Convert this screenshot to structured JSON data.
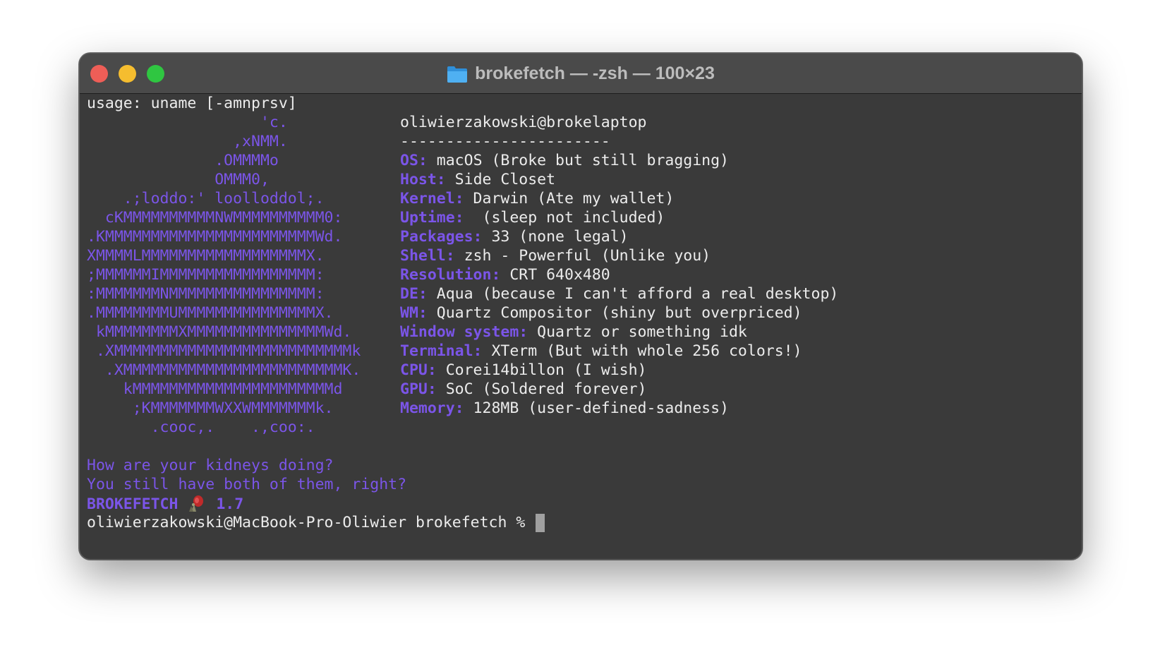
{
  "window": {
    "title": "brokefetch — -zsh — 100×23"
  },
  "terminal": {
    "usage_line": "usage: uname [-amnprsv]",
    "ascii_art": [
      "                   'c.",
      "                ,xNMM.",
      "              .OMMMMo",
      "              OMMM0,",
      "    .;loddo:' loolloddol;.",
      "  cKMMMMMMMMMMNWMMMMMMMMMM0:",
      ".KMMMMMMMMMMMMMMMMMMMMMMMWd.",
      "XMMMMLMMMMMMMMMMMMMMMMMMX.",
      ";MMMMMMIMMMMMMMMMMMMMMMMM:",
      ":MMMMMMMNMMMMMMMMMMMMMMMM:",
      ".MMMMMMMMUMMMMMMMMMMMMMMMX.",
      " kMMMMMMMMXMMMMMMMMMMMMMMMWd.",
      " .XMMMMMMMMMMMMMMMMMMMMMMMMMMk",
      "  .XMMMMMMMMMMMMMMMMMMMMMMMMK.",
      "    kMMMMMMMMMMMMMMMMMMMMMMd",
      "     ;KMMMMMMMWXXWMMMMMMMk.",
      "       .cooc,.    .,coo:."
    ],
    "user_host": "oliwierzakowski@brokelaptop",
    "separator": "-----------------------",
    "info": [
      {
        "key": "OS:",
        "value": " macOS (Broke but still bragging)"
      },
      {
        "key": "Host:",
        "value": " Side Closet"
      },
      {
        "key": "Kernel:",
        "value": " Darwin (Ate my wallet)"
      },
      {
        "key": "Uptime:",
        "value": "  (sleep not included)"
      },
      {
        "key": "Packages:",
        "value": " 33 (none legal)"
      },
      {
        "key": "Shell:",
        "value": " zsh - Powerful (Unlike you)"
      },
      {
        "key": "Resolution:",
        "value": " CRT 640x480"
      },
      {
        "key": "DE:",
        "value": " Aqua (because I can't afford a real desktop)"
      },
      {
        "key": "WM:",
        "value": " Quartz Compositor (shiny but overpriced)"
      },
      {
        "key": "Window system:",
        "value": " Quartz or something idk"
      },
      {
        "key": "Terminal:",
        "value": " XTerm (But with whole 256 colors!)"
      },
      {
        "key": "CPU:",
        "value": " Corei14billon (I wish)"
      },
      {
        "key": "GPU:",
        "value": " SoC (Soldered forever)"
      },
      {
        "key": "Memory:",
        "value": " 128MB (user-defined-sadness)"
      }
    ],
    "message_1": "How are your kidneys doing?",
    "message_2": "You still have both of them, right?",
    "brand": "BROKEFETCH",
    "version": "1.7",
    "prompt": "oliwierzakowski@MacBook-Pro-Oliwier brokefetch % "
  },
  "colors": {
    "accent": "#7b55e8",
    "background": "#3a3a3a",
    "text": "#ececec"
  }
}
